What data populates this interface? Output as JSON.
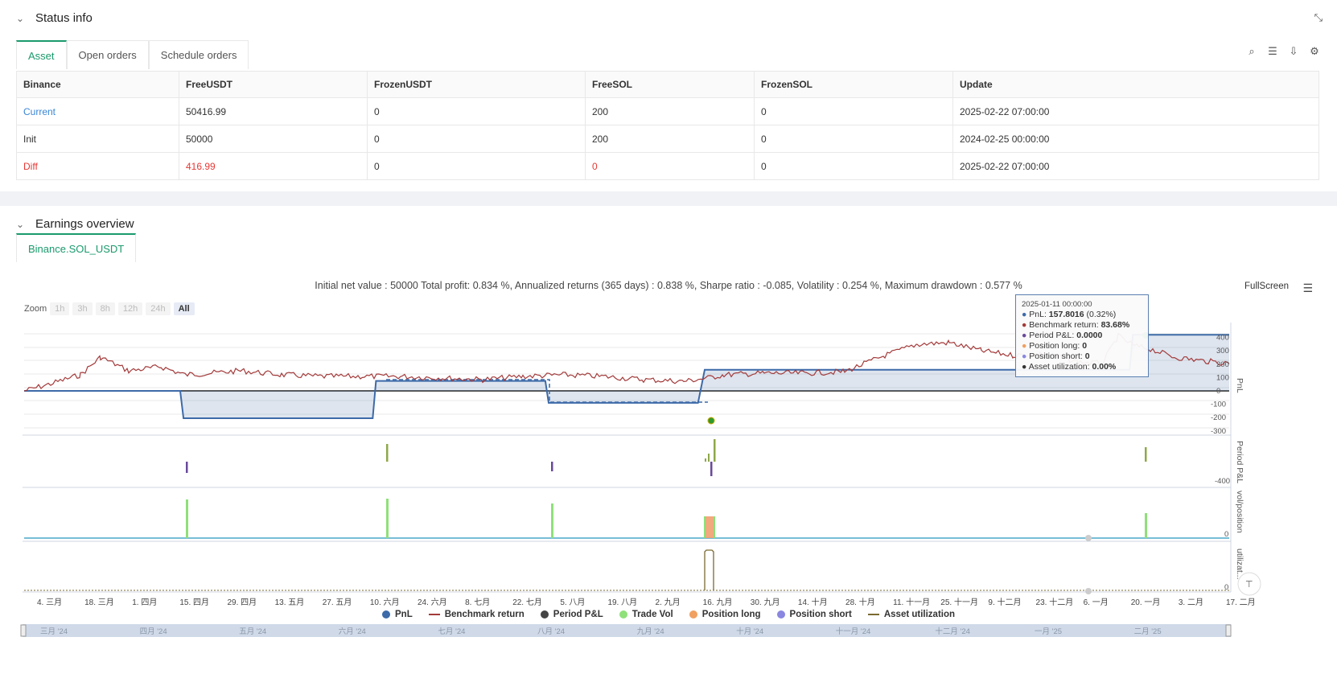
{
  "status": {
    "title": "Status info",
    "tabs": [
      "Asset",
      "Open orders",
      "Schedule orders"
    ],
    "columns": [
      "Binance",
      "FreeUSDT",
      "FrozenUSDT",
      "FreeSOL",
      "FrozenSOL",
      "Update"
    ],
    "rows": [
      [
        "Current",
        "50416.99",
        "0",
        "200",
        "0",
        "2025-02-22 07:00:00"
      ],
      [
        "Init",
        "50000",
        "0",
        "200",
        "0",
        "2024-02-25 00:00:00"
      ],
      [
        "Diff",
        "416.99",
        "0",
        "0",
        "0",
        "2025-02-22 07:00:00"
      ]
    ]
  },
  "earnings": {
    "title": "Earnings overview",
    "tab": "Binance.SOL_USDT",
    "summary": "Initial net value : 50000 Total profit: 0.834 %, Annualized returns (365 days) : 0.838 %, Sharpe ratio : -0.085, Volatility : 0.254 %, Maximum drawdown : 0.577 %",
    "fullscreen": "FullScreen",
    "zoom_label": "Zoom",
    "zoom_options": [
      "1h",
      "3h",
      "8h",
      "12h",
      "24h",
      "All"
    ],
    "tooltip": {
      "time": "2025-01-11 00:00:00",
      "pnl_label": "PnL:",
      "pnl_value": "157.8016",
      "pnl_pct": "(0.32%)",
      "bench_label": "Benchmark return:",
      "bench_value": "83.68%",
      "period_label": "Period P&L:",
      "period_value": "0.0000",
      "long_label": "Position long:",
      "long_value": "0",
      "short_label": "Position short:",
      "short_value": "0",
      "util_label": "Asset utilization:",
      "util_value": "0.00%"
    },
    "legend": [
      "PnL",
      "Benchmark return",
      "Period P&L",
      "Trade Vol",
      "Position long",
      "Position short",
      "Asset utilization"
    ],
    "colors": {
      "pnl": "#3d6aa8",
      "benchmark": "#a33a3a",
      "period": "#444444",
      "tradevol": "#8fe07a",
      "long": "#f0a060",
      "short": "#8a87e0",
      "util": "#7a6a30",
      "accent": "#1a9a6c"
    }
  },
  "chart_data": {
    "type": "line",
    "x_ticks": [
      "4. 三月",
      "18. 三月",
      "1. 四月",
      "15. 四月",
      "29. 四月",
      "13. 五月",
      "27. 五月",
      "10. 六月",
      "24. 六月",
      "8. 七月",
      "22. 七月",
      "5. 八月",
      "19. 八月",
      "2. 九月",
      "16. 九月",
      "30. 九月",
      "14. 十月",
      "28. 十月",
      "11. 十一月",
      "25. 十一月",
      "9. 十二月",
      "23. 十二月",
      "6. 一月",
      "20. 一月",
      "3. 二月",
      "17. 二月"
    ],
    "navigator_ticks": [
      "三月 '24",
      "四月 '24",
      "五月 '24",
      "六月 '24",
      "七月 '24",
      "八月 '24",
      "九月 '24",
      "十月 '24",
      "十一月 '24",
      "十二月 '24",
      "一月 '25",
      "二月 '25"
    ],
    "pnl_axis": {
      "label": "PnL",
      "ticks": [
        400,
        300,
        200,
        100,
        0,
        -100,
        -200,
        -300
      ]
    },
    "period_axis": {
      "label": "Period P&L",
      "ticks": [
        -400
      ]
    },
    "vol_axis": {
      "label": "vol/position",
      "ticks": [
        0
      ]
    },
    "util_axis": {
      "label": "utilizat...",
      "ticks": [
        0
      ]
    },
    "pnl_series": [
      {
        "x": "2024-02-25",
        "y": 0
      },
      {
        "x": "2024-04-12",
        "y": 0
      },
      {
        "x": "2024-04-13",
        "y": -205
      },
      {
        "x": "2024-06-09",
        "y": -205
      },
      {
        "x": "2024-06-10",
        "y": 75
      },
      {
        "x": "2024-07-31",
        "y": 75
      },
      {
        "x": "2024-08-01",
        "y": -90
      },
      {
        "x": "2024-09-15",
        "y": -90
      },
      {
        "x": "2024-09-17",
        "y": 157.8
      },
      {
        "x": "2025-01-23",
        "y": 157.8
      },
      {
        "x": "2025-01-24",
        "y": 420
      },
      {
        "x": "2025-02-22",
        "y": 420
      }
    ]
  }
}
